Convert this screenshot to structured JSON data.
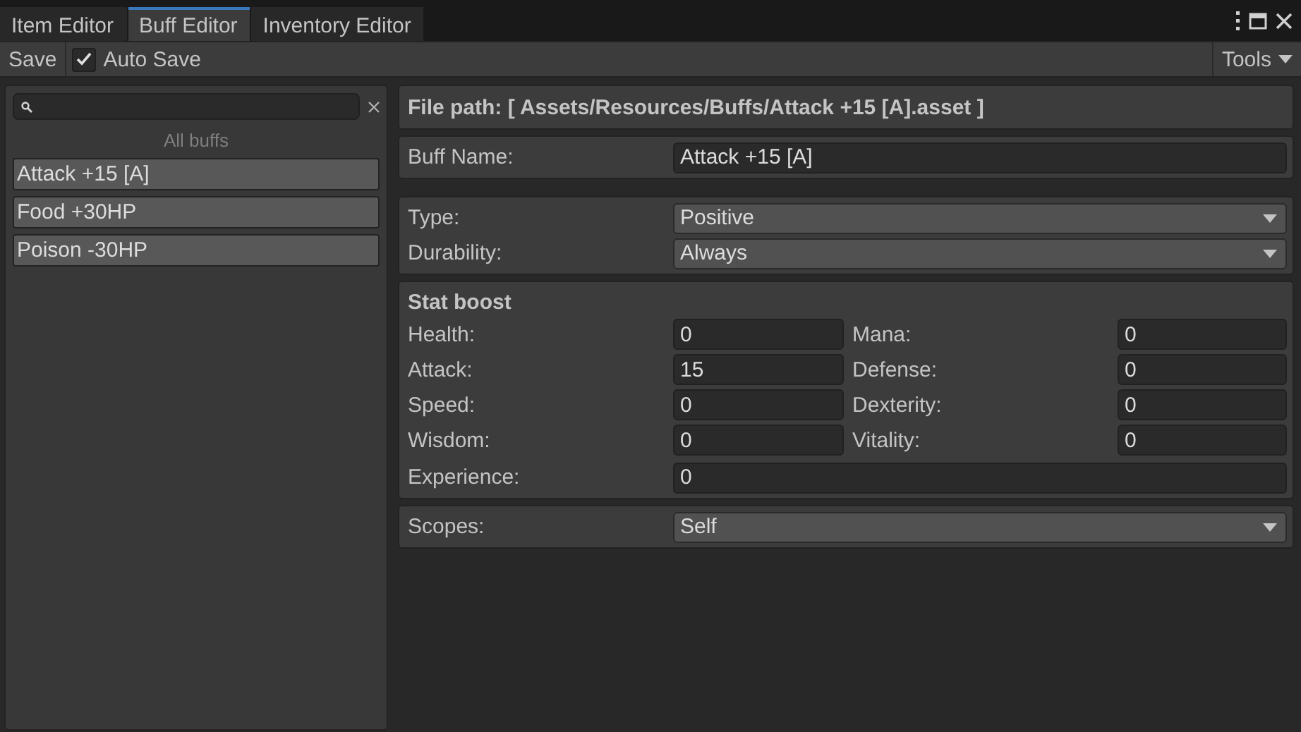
{
  "tabs": [
    {
      "label": "Item Editor",
      "selected": false
    },
    {
      "label": "Buff Editor",
      "selected": true
    },
    {
      "label": "Inventory Editor",
      "selected": false
    }
  ],
  "toolbar": {
    "save": "Save",
    "auto_save": {
      "label": "Auto Save",
      "checked": true
    },
    "tools": "Tools"
  },
  "sidebar": {
    "list_title": "All buffs",
    "items": [
      {
        "label": "Attack +15 [A]",
        "selected": false
      },
      {
        "label": "Food +30HP",
        "selected": false
      },
      {
        "label": "Poison -30HP",
        "selected": false
      }
    ]
  },
  "form": {
    "file_path": "File path: [ Assets/Resources/Buffs/Attack +15 [A].asset ]",
    "buff_name": {
      "label": "Buff Name:",
      "value": "Attack +15 [A]"
    },
    "type": {
      "label": "Type:",
      "value": "Positive"
    },
    "durability": {
      "label": "Durability:",
      "value": "Always"
    },
    "stat_boost": {
      "title": "Stat boost",
      "stats": [
        {
          "label": "Health:",
          "value": "0"
        },
        {
          "label": "Mana:",
          "value": "0"
        },
        {
          "label": "Attack:",
          "value": "15"
        },
        {
          "label": "Defense:",
          "value": "0"
        },
        {
          "label": "Speed:",
          "value": "0"
        },
        {
          "label": "Dexterity:",
          "value": "0"
        },
        {
          "label": "Wisdom:",
          "value": "0"
        },
        {
          "label": "Vitality:",
          "value": "0"
        }
      ],
      "experience": {
        "label": "Experience:",
        "value": "0"
      }
    },
    "scopes": {
      "label": "Scopes:",
      "value": "Self"
    }
  }
}
